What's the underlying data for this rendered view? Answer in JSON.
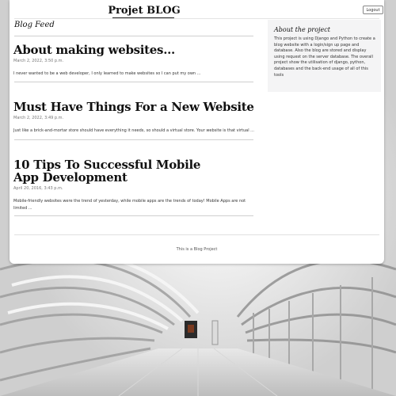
{
  "header": {
    "site_title": "Projet BLOG",
    "logout_label": "Logout"
  },
  "feed": {
    "heading": "Blog Feed",
    "posts": [
      {
        "title": "About making websites...",
        "date": "March 2, 2022, 3:50 p.m.",
        "excerpt": "I never wanted to be a web developer, I only learned to make websites so I can put my own ..."
      },
      {
        "title": "Must Have Things For a New Website",
        "date": "March 2, 2022, 3:49 p.m.",
        "excerpt": "Just like a brick-and-mortar store should have everything it needs, so should a virtual store. Your website is that virtual ..."
      },
      {
        "title": "10 Tips To Successful Mobile App Development",
        "date": "April 20, 2016, 3:43 p.m.",
        "excerpt": "Mobile-friendly websites were the trend of yesterday, while mobile apps are the trends of today! Mobile Apps are not limited ..."
      }
    ]
  },
  "sidebar": {
    "title": "About the project",
    "text": "This project is using Django and Python to create a blog website with a login/sign up page and database. Also the blog are stored and display using request on the server database. The overall project show the utilisation of django, python, databases and the back-end usage of all of this tools"
  },
  "footer": {
    "text": "This is a Blog Project"
  }
}
